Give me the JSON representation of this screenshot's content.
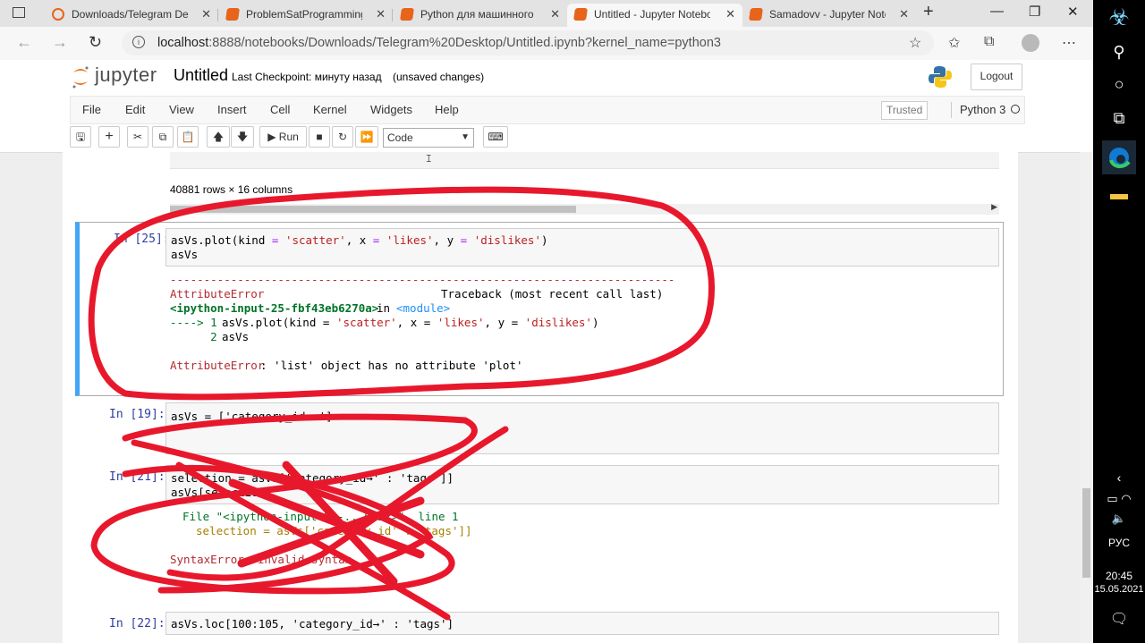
{
  "browser": {
    "tabs": [
      {
        "label": "Downloads/Telegram Desk",
        "active": false
      },
      {
        "label": "ProblemSatProgramming -",
        "active": false
      },
      {
        "label": "Python для машинного об",
        "active": false
      },
      {
        "label": "Untitled - Jupyter Noteboo",
        "active": true
      },
      {
        "label": "Samadovv - Jupyter Noteb",
        "active": false
      }
    ],
    "url_host": "localhost",
    "url_rest": ":8888/notebooks/Downloads/Telegram%20Desktop/Untitled.ipynb?kernel_name=python3"
  },
  "jupyter": {
    "logo_text": "jupyter",
    "notebook_name": "Untitled",
    "checkpoint": "Last Checkpoint: минуту назад",
    "unsaved": "(unsaved changes)",
    "logout_label": "Logout",
    "menu": [
      "File",
      "Edit",
      "View",
      "Insert",
      "Cell",
      "Kernel",
      "Widgets",
      "Help"
    ],
    "trusted": "Trusted",
    "kernel": "Python 3",
    "run_label": "Run",
    "cell_type": "Code"
  },
  "output": {
    "rowcount": "40881 rows × 16 columns"
  },
  "cells": [
    {
      "prompt": "In [25]:",
      "code": [
        "asVs.plot(kind = 'scatter', x = 'likes', y = 'dislikes')",
        "asVs"
      ],
      "traceback": {
        "dashes": "---------------------------------------------------------------------------",
        "error_name": "AttributeError",
        "traceback_label": "Traceback (most recent call last)",
        "location": "<ipython-input-25-fbf43eb6270a>",
        "in_word": "in",
        "module": "<module>",
        "arrow": "----> 1",
        "line1": "asVs.plot(kind = 'scatter', x = 'likes', y = 'dislikes')",
        "lineno2": "      2",
        "line2": "asVs",
        "final_name": "AttributeError",
        "final_msg": ": 'list' object has no attribute 'plot'"
      }
    },
    {
      "prompt": "In [19]:",
      "code": [
        "asVs = ['category_id→→']"
      ]
    },
    {
      "prompt": "In [21]:",
      "code": [
        "selection = asVs['category_id→' : 'tags']]",
        "asVs[selection]"
      ],
      "error": {
        "file_line": "File \"<ipython-input-21-...0122>\", line 1",
        "code_line": "selection = asVs['category_id' : 'tags']]",
        "message": "SyntaxError: invalid syntax"
      }
    },
    {
      "prompt": "In [22]:",
      "code": [
        "asVs.loc[100:105, 'category_id→' : 'tags']"
      ]
    }
  ],
  "taskbar": {
    "lang": "РУС",
    "time": "20:45",
    "date": "15.05.2021"
  },
  "colors": {
    "selected_cell_border": "#42a5f5",
    "error_red": "#b22b31",
    "scribble_red": "#e8182c",
    "prompt_blue": "#303f9f"
  }
}
